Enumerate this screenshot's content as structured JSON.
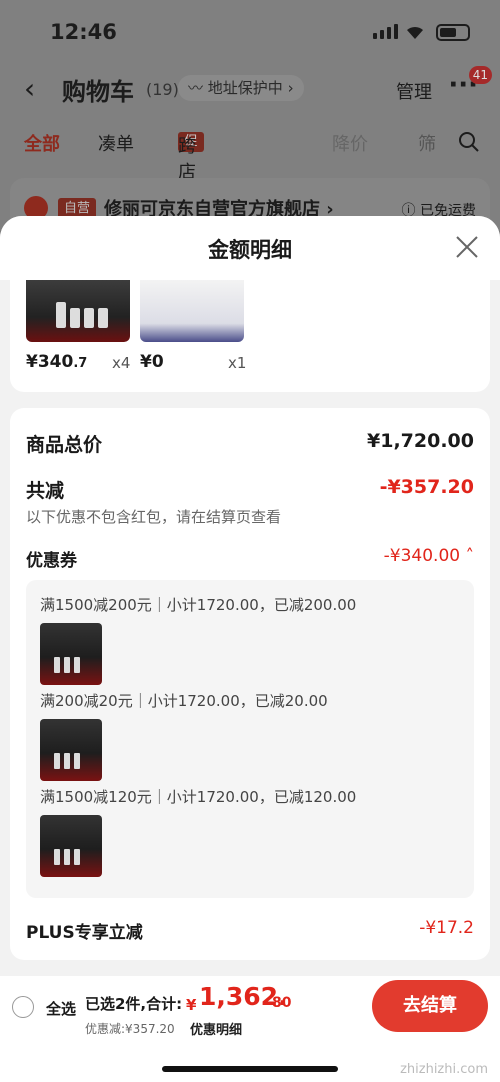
{
  "status": {
    "time": "12:46"
  },
  "nav": {
    "title": "购物车",
    "count": "(19)",
    "address_protect": "地址保护中",
    "manage": "管理",
    "more_badge": "41"
  },
  "tabs": {
    "all": "全部",
    "bundle": "凑单",
    "promo_tag": "促",
    "cross_store": "跨店满减",
    "price_drop": "降价",
    "filter": "筛"
  },
  "store": {
    "tag": "自营",
    "name": "修丽可京东自营官方旗舰店",
    "arrow": "›",
    "shipping": "已免运费"
  },
  "sheet": {
    "title": "金额明细",
    "products": [
      {
        "price_main": "¥340",
        "price_dec": ".7",
        "qty": "x4"
      },
      {
        "price_main": "¥0",
        "price_dec": "",
        "qty": "x1"
      }
    ],
    "total_label": "商品总价",
    "total_value": "¥1,720.00",
    "reduce_label": "共减",
    "reduce_value": "-¥357.20",
    "reduce_note": "以下优惠不包含红包，请在结算页查看",
    "coupon_label": "优惠券",
    "coupon_value": "-¥340.00 ˄",
    "coupons": [
      {
        "text": "满1500减200元｜小计1720.00，已减200.00"
      },
      {
        "text": "满200减20元｜小计1720.00，已减20.00"
      },
      {
        "text": "满1500减120元｜小计1720.00，已减120.00"
      }
    ],
    "plus_label": "PLUS专享立减",
    "plus_value": "-¥17.2"
  },
  "bottom": {
    "select_all": "全选",
    "picked": "已选2件,合计:",
    "currency": "¥",
    "total_int": "1,362.",
    "total_dec": "80",
    "discount": "优惠减:¥357.20",
    "detail_link": "优惠明细",
    "checkout": "去结算",
    "watermark": "zhizhizhi.com"
  },
  "colors": {
    "accent": "#e1251b",
    "checkout": "#e23b2e"
  }
}
